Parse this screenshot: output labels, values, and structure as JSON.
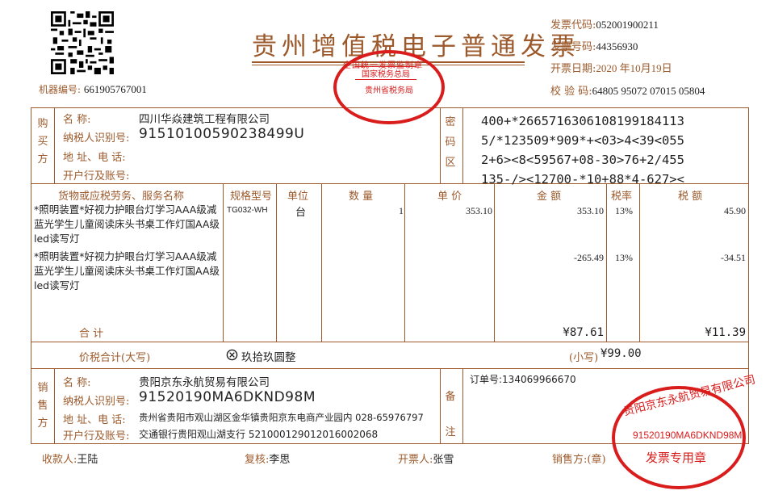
{
  "title": "贵州增值税电子普通发票",
  "header": {
    "code_label": "发票代码:",
    "code_value": "052001900211",
    "number_label": "发票号码:",
    "number_value": "44356930",
    "date_label": "开票日期:",
    "date_value": "2020 年10月19日",
    "check_label": "校 验 码:",
    "check_value": "64805 95072 07015 05804",
    "machine_label": "机器编号:",
    "machine_value": "661905767001"
  },
  "buyer": {
    "section_label": "购买方",
    "name_label": "名        称:",
    "name": "四川华焱建筑工程有限公司",
    "tax_id_label": "纳税人识别号:",
    "tax_id": "91510100590238499U",
    "address_label": "地  址、电  话:",
    "address": "",
    "bank_label": "开户行及账号:",
    "bank": ""
  },
  "cipher": {
    "section_label": "密码区",
    "lines": [
      "400+*2665716306108199184113",
      "5/*123509*909*+<03>4<39<055",
      "2+6><8<59567+08-30>76+2/455",
      "135-/><12700-*10+88*4-627><"
    ]
  },
  "table": {
    "headers": {
      "goods": "货物或应税劳务、服务名称",
      "spec": "规格型号",
      "unit": "单位",
      "qty": "数 量",
      "price": "单 价",
      "amount": "金 额",
      "rate": "税率",
      "tax": "税 额"
    },
    "rows": [
      {
        "goods": "*照明装置*好视力护眼台灯学习AAA级减蓝光学生儿童阅读床头书桌工作灯国AA级led读写灯",
        "spec": "TG032-WH",
        "unit": "台",
        "qty": "1",
        "price": "353.10",
        "amount": "353.10",
        "rate": "13%",
        "tax": "45.90"
      },
      {
        "goods": "*照明装置*好视力护眼台灯学习AAA级减蓝光学生儿童阅读床头书桌工作灯国AA级led读写灯",
        "spec": "",
        "unit": "",
        "qty": "",
        "price": "",
        "amount": "-265.49",
        "rate": "13%",
        "tax": "-34.51"
      }
    ],
    "total_label": "合        计",
    "total_amount": "¥87.61",
    "total_tax": "¥11.39"
  },
  "total_with_tax": {
    "label": "价税合计(大写)",
    "upper_icon": "circled-x-icon",
    "upper": "玖拾玖圆整",
    "lower_label": "(小写)",
    "lower": "¥99.00"
  },
  "seller": {
    "section_label": "销售方",
    "name_label": "名        称:",
    "name": "贵阳京东永航贸易有限公司",
    "tax_id_label": "纳税人识别号:",
    "tax_id": "91520190MA6DKND98M",
    "address_label": "地  址、电  话:",
    "address": "贵州省贵阳市观山湖区金华镇贵阳京东电商产业园内 028-65976797",
    "bank_label": "开户行及账号:",
    "bank": "交通银行贵阳观山湖支行 521000129012016002068"
  },
  "remarks": {
    "section_label": "备注",
    "text": "订单号:134069966670"
  },
  "footer": {
    "payee_label": "收款人:",
    "payee": "王陆",
    "reviewer_label": "复核:",
    "reviewer": "李思",
    "issuer_label": "开票人:",
    "issuer": "张雪",
    "seller_label": "销售方:(章)"
  },
  "stamps": {
    "tax_seal_top": "全国统一发票监制章",
    "tax_seal_mid": "国家税务总局",
    "tax_seal_bottom": "贵州省税务局",
    "seller_seal_top": "贵阳京东永航贸易有限公司",
    "seller_seal_id": "91520190MA6DKND98M",
    "seller_seal_bottom": "发票专用章"
  },
  "colors": {
    "frame": "#9c5a2c",
    "stamp": "#d91c1c"
  }
}
